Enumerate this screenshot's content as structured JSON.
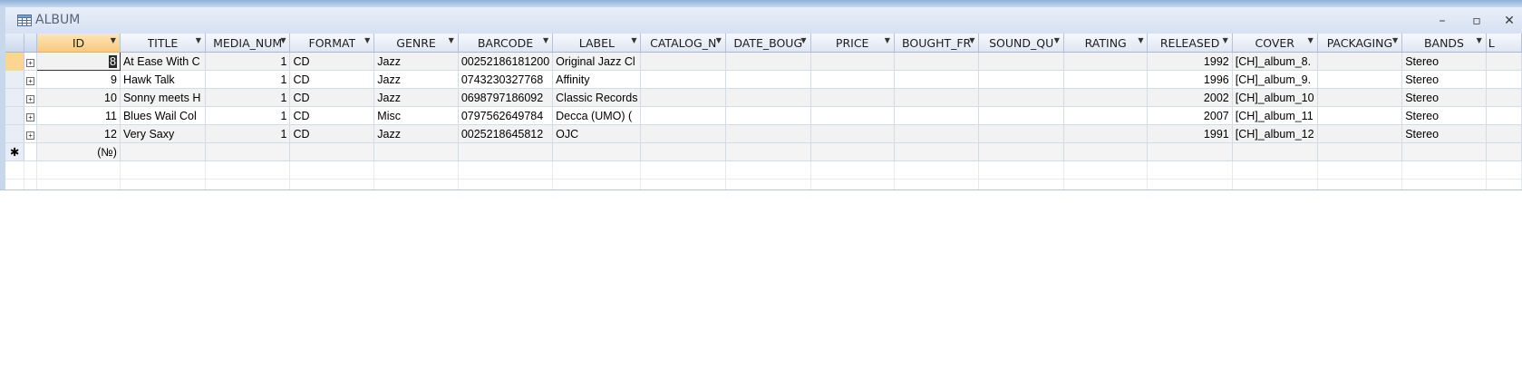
{
  "window": {
    "title": "ALBUM",
    "minimize_glyph": "–",
    "maximize_glyph": "▫",
    "close_glyph": "✕"
  },
  "columns": [
    {
      "label": "ID",
      "selected": true
    },
    {
      "label": "TITLE"
    },
    {
      "label": "MEDIA_NUM"
    },
    {
      "label": "FORMAT"
    },
    {
      "label": "GENRE"
    },
    {
      "label": "BARCODE"
    },
    {
      "label": "LABEL"
    },
    {
      "label": "CATALOG_N"
    },
    {
      "label": "DATE_BOUG"
    },
    {
      "label": "PRICE"
    },
    {
      "label": "BOUGHT_FR"
    },
    {
      "label": "SOUND_QU"
    },
    {
      "label": "RATING"
    },
    {
      "label": "RELEASED"
    },
    {
      "label": "COVER"
    },
    {
      "label": "PACKAGING"
    },
    {
      "label": "BANDS"
    },
    {
      "label": "L"
    }
  ],
  "rows": [
    {
      "id": "8",
      "title": "At Ease With C",
      "media_num": "1",
      "format": "CD",
      "genre": "Jazz",
      "barcode": "00252186181200",
      "label": "Original Jazz Cl",
      "catalog": "",
      "date_bought": "",
      "price": "",
      "bought_from": "",
      "sound_quality": "",
      "rating": "",
      "released": "1992",
      "cover": "[CH]_album_8.",
      "packaging": "",
      "bands": "Stereo",
      "l": ""
    },
    {
      "id": "9",
      "title": "Hawk Talk",
      "media_num": "1",
      "format": "CD",
      "genre": "Jazz",
      "barcode": "0743230327768",
      "label": "Affinity",
      "catalog": "",
      "date_bought": "",
      "price": "",
      "bought_from": "",
      "sound_quality": "",
      "rating": "",
      "released": "1996",
      "cover": "[CH]_album_9.",
      "packaging": "",
      "bands": "Stereo",
      "l": ""
    },
    {
      "id": "10",
      "title": "Sonny meets H",
      "media_num": "1",
      "format": "CD",
      "genre": "Jazz",
      "barcode": "0698797186092",
      "label": "Classic Records",
      "catalog": "",
      "date_bought": "",
      "price": "",
      "bought_from": "",
      "sound_quality": "",
      "rating": "",
      "released": "2002",
      "cover": "[CH]_album_10",
      "packaging": "",
      "bands": "Stereo",
      "l": ""
    },
    {
      "id": "11",
      "title": "Blues Wail Col",
      "media_num": "1",
      "format": "CD",
      "genre": "Misc",
      "barcode": "0797562649784",
      "label": "Decca (UMO) (",
      "catalog": "",
      "date_bought": "",
      "price": "",
      "bought_from": "",
      "sound_quality": "",
      "rating": "",
      "released": "2007",
      "cover": "[CH]_album_11",
      "packaging": "",
      "bands": "Stereo",
      "l": ""
    },
    {
      "id": "12",
      "title": "Very Saxy",
      "media_num": "1",
      "format": "CD",
      "genre": "Jazz",
      "barcode": "0025218645812",
      "label": "OJC",
      "catalog": "",
      "date_bought": "",
      "price": "",
      "bought_from": "",
      "sound_quality": "",
      "rating": "",
      "released": "1991",
      "cover": "[CH]_album_12",
      "packaging": "",
      "bands": "Stereo",
      "l": ""
    }
  ],
  "new_row": {
    "marker": "✱",
    "id_placeholder": "(№)"
  },
  "icons": {
    "title": "table-icon",
    "expand": "plus-box-icon",
    "sort": "dropdown-arrow-icon"
  },
  "colors": {
    "selected_header": "#f9c97e",
    "header": "#dfe7f3",
    "title_bar": "#d6e1f1"
  }
}
